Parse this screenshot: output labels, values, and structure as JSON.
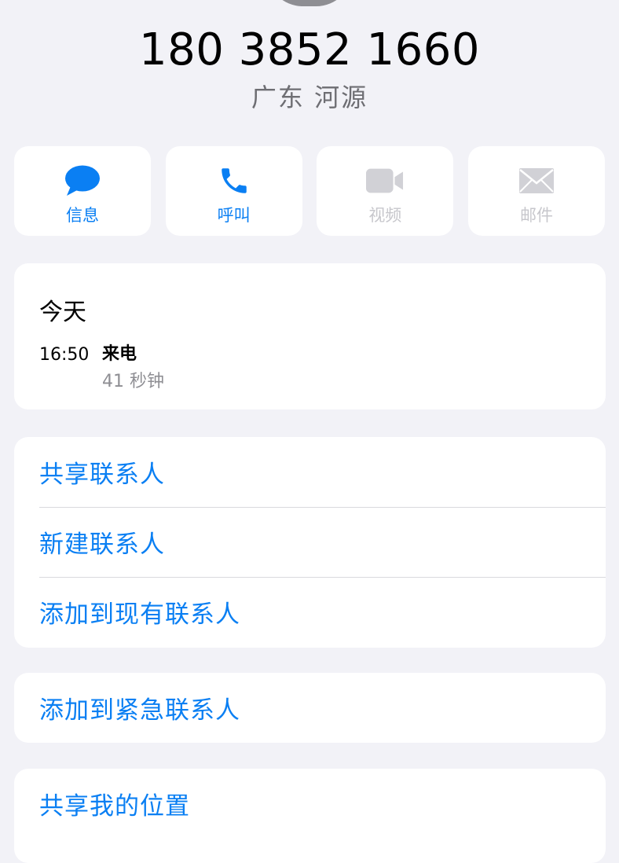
{
  "contact": {
    "phone_number": "180 3852 1660",
    "location": "广东 河源"
  },
  "actions": [
    {
      "label": "信息",
      "icon": "message-bubble-icon",
      "enabled": true
    },
    {
      "label": "呼叫",
      "icon": "phone-icon",
      "enabled": true
    },
    {
      "label": "视频",
      "icon": "video-camera-icon",
      "enabled": false
    },
    {
      "label": "邮件",
      "icon": "envelope-icon",
      "enabled": false
    }
  ],
  "recents": {
    "day": "今天",
    "time": "16:50",
    "type": "来电",
    "duration": "41 秒钟"
  },
  "contact_options": {
    "share_contact": "共享联系人",
    "new_contact": "新建联系人",
    "add_to_existing": "添加到现有联系人"
  },
  "emergency": {
    "add_to_emergency": "添加到紧急联系人"
  },
  "location_sharing": {
    "share_my_location": "共享我的位置"
  },
  "colors": {
    "accent": "#0a7ff3",
    "disabled": "#c7c7cc",
    "background": "#f2f2f7",
    "card": "#ffffff",
    "secondary_text": "#6e6e73"
  }
}
